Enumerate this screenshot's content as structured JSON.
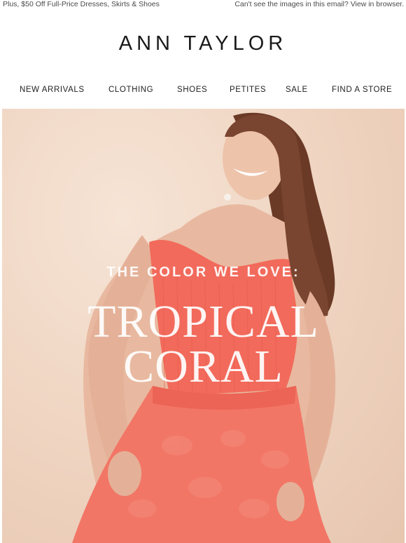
{
  "preheader": {
    "left_text": "Plus, $50 Off Full-Price Dresses, Skirts & Shoes",
    "right_text": "Can't see the images in this email? View in browser."
  },
  "brand": {
    "logo_text": "ANN TAYLOR"
  },
  "nav": {
    "items": [
      {
        "label": "NEW ARRIVALS"
      },
      {
        "label": "CLOTHING"
      },
      {
        "label": "SHOES"
      },
      {
        "label": "PETITES"
      },
      {
        "label": "SALE"
      },
      {
        "label": "FIND A STORE"
      }
    ]
  },
  "hero": {
    "kicker": "THE COLOR WE LOVE:",
    "title_line1": "TROPICAL",
    "title_line2": "CORAL",
    "colors": {
      "background": "#f0d6c3",
      "coral": "#f26a5b",
      "hair": "#6b3a26",
      "skin": "#e8b9a0"
    }
  }
}
